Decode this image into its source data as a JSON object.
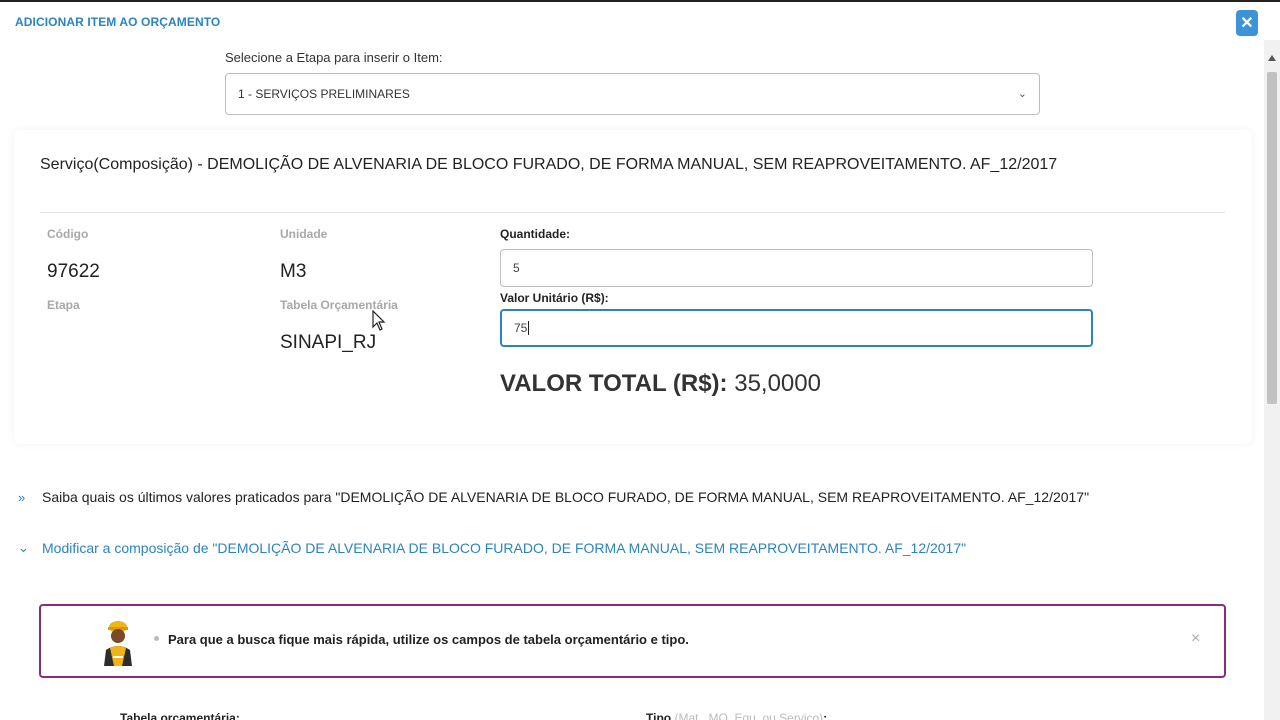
{
  "modal": {
    "title": "ADICIONAR ITEM AO ORÇAMENTO",
    "close_label": "✕"
  },
  "stage": {
    "label": "Selecione a Etapa para inserir o Item:",
    "selected": "1 - SERVIÇOS PRELIMINARES"
  },
  "service": {
    "title": "Serviço(Composição) - DEMOLIÇÃO DE ALVENARIA DE BLOCO FURADO, DE FORMA MANUAL, SEM REAPROVEITAMENTO. AF_12/2017",
    "codigo_label": "Código",
    "codigo_value": "97622",
    "unidade_label": "Unidade",
    "unidade_value": "M3",
    "etapa_label": "Etapa",
    "tabela_label": "Tabela Orçamentária",
    "tabela_value": "SINAPI_RJ",
    "quantidade_label": "Quantidade:",
    "quantidade_value": "5",
    "valor_unitario_label": "Valor Unitário (R$):",
    "valor_unitario_value": "75",
    "total_label": "VALOR TOTAL (R$):",
    "total_value": "35,0000"
  },
  "accordion": {
    "item1": "Saiba quais os últimos valores praticados para \"DEMOLIÇÃO DE ALVENARIA DE BLOCO FURADO, DE FORMA MANUAL, SEM REAPROVEITAMENTO. AF_12/2017\"",
    "item2": "Modificar a composição de \"DEMOLIÇÃO DE ALVENARIA DE BLOCO FURADO, DE FORMA MANUAL, SEM REAPROVEITAMENTO. AF_12/2017\""
  },
  "alert": {
    "message": "Para que a busca fique mais rápida, utilize os campos de tabela orçamentário e tipo.",
    "close_label": "×"
  },
  "filters": {
    "tabela_label": "Tabela orçamentária:",
    "tipo_label": "Tipo",
    "tipo_hint": "(Mat., MO, Equ. ou Serviço)",
    "tipo_colon": ":"
  },
  "colors": {
    "accent": "#2a83c6",
    "alert_border": "#8e2a7c"
  }
}
